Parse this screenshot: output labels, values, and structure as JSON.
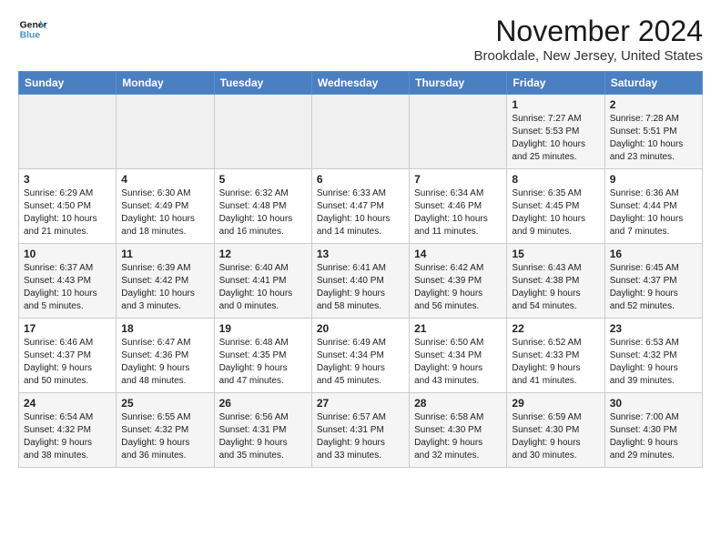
{
  "logo": {
    "line1": "General",
    "line2": "Blue"
  },
  "title": "November 2024",
  "location": "Brookdale, New Jersey, United States",
  "days_of_week": [
    "Sunday",
    "Monday",
    "Tuesday",
    "Wednesday",
    "Thursday",
    "Friday",
    "Saturday"
  ],
  "weeks": [
    [
      {
        "day": "",
        "content": ""
      },
      {
        "day": "",
        "content": ""
      },
      {
        "day": "",
        "content": ""
      },
      {
        "day": "",
        "content": ""
      },
      {
        "day": "",
        "content": ""
      },
      {
        "day": "1",
        "content": "Sunrise: 7:27 AM\nSunset: 5:53 PM\nDaylight: 10 hours\nand 25 minutes."
      },
      {
        "day": "2",
        "content": "Sunrise: 7:28 AM\nSunset: 5:51 PM\nDaylight: 10 hours\nand 23 minutes."
      }
    ],
    [
      {
        "day": "3",
        "content": "Sunrise: 6:29 AM\nSunset: 4:50 PM\nDaylight: 10 hours\nand 21 minutes."
      },
      {
        "day": "4",
        "content": "Sunrise: 6:30 AM\nSunset: 4:49 PM\nDaylight: 10 hours\nand 18 minutes."
      },
      {
        "day": "5",
        "content": "Sunrise: 6:32 AM\nSunset: 4:48 PM\nDaylight: 10 hours\nand 16 minutes."
      },
      {
        "day": "6",
        "content": "Sunrise: 6:33 AM\nSunset: 4:47 PM\nDaylight: 10 hours\nand 14 minutes."
      },
      {
        "day": "7",
        "content": "Sunrise: 6:34 AM\nSunset: 4:46 PM\nDaylight: 10 hours\nand 11 minutes."
      },
      {
        "day": "8",
        "content": "Sunrise: 6:35 AM\nSunset: 4:45 PM\nDaylight: 10 hours\nand 9 minutes."
      },
      {
        "day": "9",
        "content": "Sunrise: 6:36 AM\nSunset: 4:44 PM\nDaylight: 10 hours\nand 7 minutes."
      }
    ],
    [
      {
        "day": "10",
        "content": "Sunrise: 6:37 AM\nSunset: 4:43 PM\nDaylight: 10 hours\nand 5 minutes."
      },
      {
        "day": "11",
        "content": "Sunrise: 6:39 AM\nSunset: 4:42 PM\nDaylight: 10 hours\nand 3 minutes."
      },
      {
        "day": "12",
        "content": "Sunrise: 6:40 AM\nSunset: 4:41 PM\nDaylight: 10 hours\nand 0 minutes."
      },
      {
        "day": "13",
        "content": "Sunrise: 6:41 AM\nSunset: 4:40 PM\nDaylight: 9 hours\nand 58 minutes."
      },
      {
        "day": "14",
        "content": "Sunrise: 6:42 AM\nSunset: 4:39 PM\nDaylight: 9 hours\nand 56 minutes."
      },
      {
        "day": "15",
        "content": "Sunrise: 6:43 AM\nSunset: 4:38 PM\nDaylight: 9 hours\nand 54 minutes."
      },
      {
        "day": "16",
        "content": "Sunrise: 6:45 AM\nSunset: 4:37 PM\nDaylight: 9 hours\nand 52 minutes."
      }
    ],
    [
      {
        "day": "17",
        "content": "Sunrise: 6:46 AM\nSunset: 4:37 PM\nDaylight: 9 hours\nand 50 minutes."
      },
      {
        "day": "18",
        "content": "Sunrise: 6:47 AM\nSunset: 4:36 PM\nDaylight: 9 hours\nand 48 minutes."
      },
      {
        "day": "19",
        "content": "Sunrise: 6:48 AM\nSunset: 4:35 PM\nDaylight: 9 hours\nand 47 minutes."
      },
      {
        "day": "20",
        "content": "Sunrise: 6:49 AM\nSunset: 4:34 PM\nDaylight: 9 hours\nand 45 minutes."
      },
      {
        "day": "21",
        "content": "Sunrise: 6:50 AM\nSunset: 4:34 PM\nDaylight: 9 hours\nand 43 minutes."
      },
      {
        "day": "22",
        "content": "Sunrise: 6:52 AM\nSunset: 4:33 PM\nDaylight: 9 hours\nand 41 minutes."
      },
      {
        "day": "23",
        "content": "Sunrise: 6:53 AM\nSunset: 4:32 PM\nDaylight: 9 hours\nand 39 minutes."
      }
    ],
    [
      {
        "day": "24",
        "content": "Sunrise: 6:54 AM\nSunset: 4:32 PM\nDaylight: 9 hours\nand 38 minutes."
      },
      {
        "day": "25",
        "content": "Sunrise: 6:55 AM\nSunset: 4:32 PM\nDaylight: 9 hours\nand 36 minutes."
      },
      {
        "day": "26",
        "content": "Sunrise: 6:56 AM\nSunset: 4:31 PM\nDaylight: 9 hours\nand 35 minutes."
      },
      {
        "day": "27",
        "content": "Sunrise: 6:57 AM\nSunset: 4:31 PM\nDaylight: 9 hours\nand 33 minutes."
      },
      {
        "day": "28",
        "content": "Sunrise: 6:58 AM\nSunset: 4:30 PM\nDaylight: 9 hours\nand 32 minutes."
      },
      {
        "day": "29",
        "content": "Sunrise: 6:59 AM\nSunset: 4:30 PM\nDaylight: 9 hours\nand 30 minutes."
      },
      {
        "day": "30",
        "content": "Sunrise: 7:00 AM\nSunset: 4:30 PM\nDaylight: 9 hours\nand 29 minutes."
      }
    ]
  ]
}
